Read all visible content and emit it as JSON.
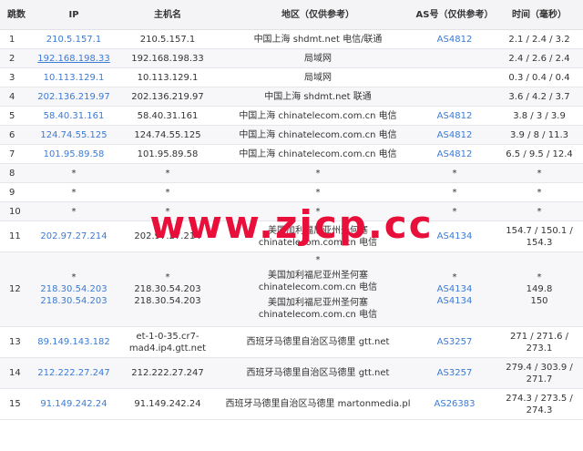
{
  "headers": {
    "hop": "跳数",
    "ip": "IP",
    "host": "主机名",
    "region": "地区（仅供参考）",
    "as": "AS号（仅供参考）",
    "time": "时间（毫秒）"
  },
  "rows": [
    {
      "hop": "1",
      "ips": [
        "210.5.157.1"
      ],
      "hosts": [
        "210.5.157.1"
      ],
      "regions": [
        "中国上海 shdmt.net 电信/联通"
      ],
      "as": [
        "AS4812"
      ],
      "time": "2.1 / 2.4 / 3.2"
    },
    {
      "hop": "2",
      "ips": [
        "192.168.198.33"
      ],
      "hosts": [
        "192.168.198.33"
      ],
      "regions": [
        "局域网"
      ],
      "as": [
        ""
      ],
      "time": "2.4 / 2.6 / 2.4"
    },
    {
      "hop": "3",
      "ips": [
        "10.113.129.1"
      ],
      "hosts": [
        "10.113.129.1"
      ],
      "regions": [
        "局域网"
      ],
      "as": [
        ""
      ],
      "time": "0.3 / 0.4 / 0.4"
    },
    {
      "hop": "4",
      "ips": [
        "202.136.219.97"
      ],
      "hosts": [
        "202.136.219.97"
      ],
      "regions": [
        "中国上海 shdmt.net 联通"
      ],
      "as": [
        ""
      ],
      "time": "3.6 / 4.2 / 3.7"
    },
    {
      "hop": "5",
      "ips": [
        "58.40.31.161"
      ],
      "hosts": [
        "58.40.31.161"
      ],
      "regions": [
        "中国上海 chinatelecom.com.cn 电信"
      ],
      "as": [
        "AS4812"
      ],
      "time": "3.8 / 3 / 3.9"
    },
    {
      "hop": "6",
      "ips": [
        "124.74.55.125"
      ],
      "hosts": [
        "124.74.55.125"
      ],
      "regions": [
        "中国上海 chinatelecom.com.cn 电信"
      ],
      "as": [
        "AS4812"
      ],
      "time": "3.9 / 8 / 11.3"
    },
    {
      "hop": "7",
      "ips": [
        "101.95.89.58"
      ],
      "hosts": [
        "101.95.89.58"
      ],
      "regions": [
        "中国上海 chinatelecom.com.cn 电信"
      ],
      "as": [
        "AS4812"
      ],
      "time": "6.5 / 9.5 / 12.4"
    },
    {
      "hop": "8",
      "ips": [
        "*"
      ],
      "hosts": [
        "*"
      ],
      "regions": [
        "*"
      ],
      "as": [
        "*"
      ],
      "time": "*"
    },
    {
      "hop": "9",
      "ips": [
        "*"
      ],
      "hosts": [
        "*"
      ],
      "regions": [
        "*"
      ],
      "as": [
        "*"
      ],
      "time": "*"
    },
    {
      "hop": "10",
      "ips": [
        "*"
      ],
      "hosts": [
        "*"
      ],
      "regions": [
        "*"
      ],
      "as": [
        "*"
      ],
      "time": "*"
    },
    {
      "hop": "11",
      "ips": [
        "202.97.27.214"
      ],
      "hosts": [
        "202.97.27.214"
      ],
      "regions": [
        "美国加利福尼亚州圣何塞 chinatelecom.com.cn 电信"
      ],
      "as": [
        "AS4134"
      ],
      "time": "154.7 / 150.1 / 154.3"
    },
    {
      "hop": "12",
      "ips": [
        "*",
        "218.30.54.203",
        "218.30.54.203"
      ],
      "hosts": [
        "*",
        "218.30.54.203",
        "218.30.54.203"
      ],
      "regions": [
        "*",
        "美国加利福尼亚州圣何塞 chinatelecom.com.cn 电信",
        "美国加利福尼亚州圣何塞 chinatelecom.com.cn 电信"
      ],
      "as": [
        "*",
        "AS4134",
        "AS4134"
      ],
      "time": "* 149.8 150"
    },
    {
      "hop": "13",
      "ips": [
        "89.149.143.182"
      ],
      "hosts": [
        "et-1-0-35.cr7-mad4.ip4.gtt.net"
      ],
      "regions": [
        "西班牙马德里自治区马德里 gtt.net"
      ],
      "as": [
        "AS3257"
      ],
      "time": "271 / 271.6 / 273.1"
    },
    {
      "hop": "14",
      "ips": [
        "212.222.27.247"
      ],
      "hosts": [
        "212.222.27.247"
      ],
      "regions": [
        "西班牙马德里自治区马德里 gtt.net"
      ],
      "as": [
        "AS3257"
      ],
      "time": "279.4 / 303.9 / 271.7"
    },
    {
      "hop": "15",
      "ips": [
        "91.149.242.24"
      ],
      "hosts": [
        "91.149.242.24"
      ],
      "regions": [
        "西班牙马德里自治区马德里 martonmedia.pl"
      ],
      "as": [
        "AS26383"
      ],
      "time": "274.3 / 273.5 / 274.3"
    }
  ],
  "watermark": "www.zjcp.cc"
}
